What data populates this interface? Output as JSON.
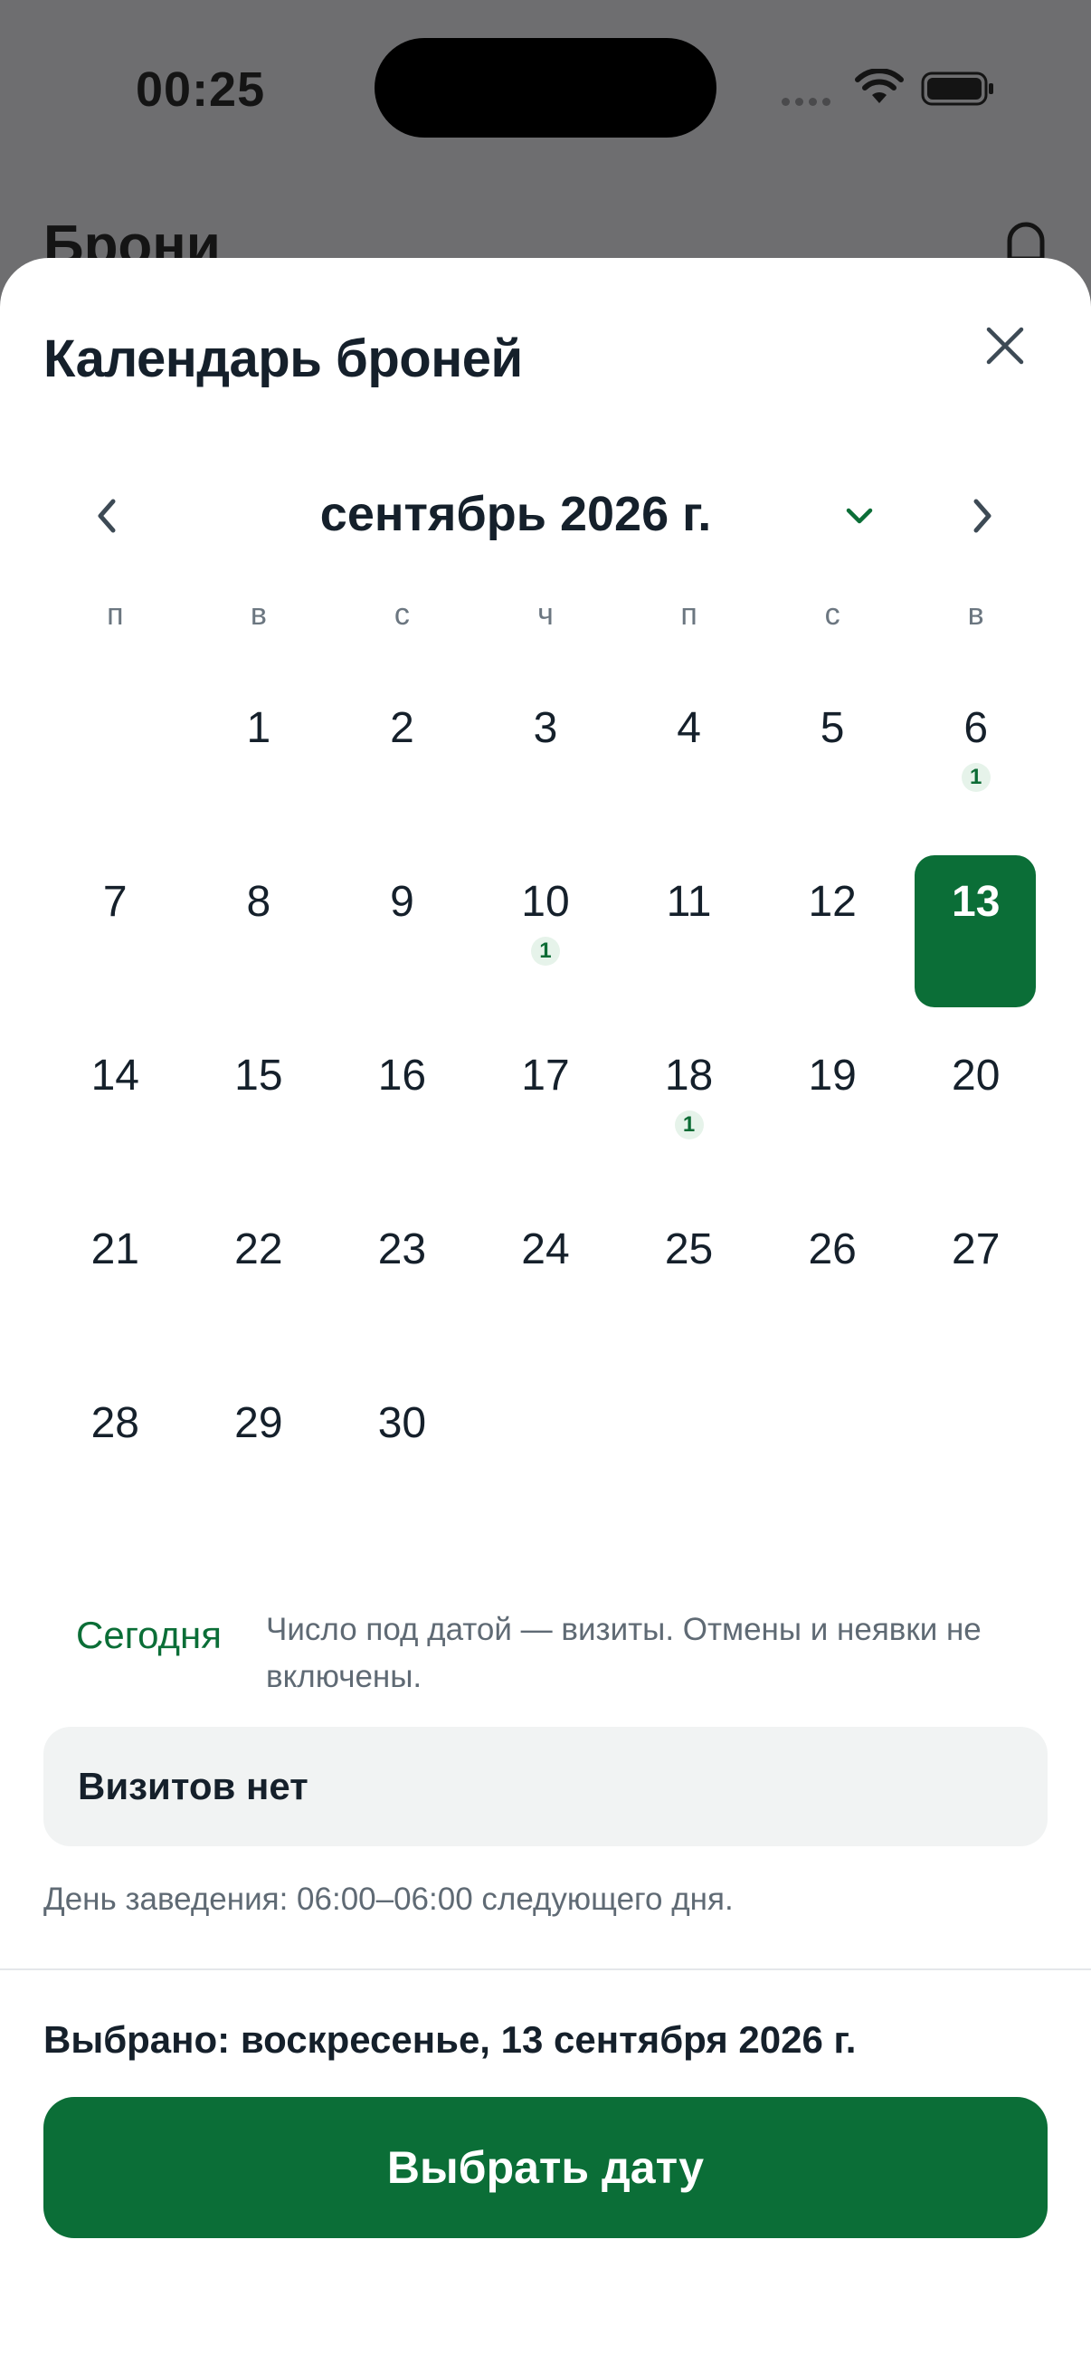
{
  "status_bar": {
    "time": "00:25"
  },
  "background": {
    "title": "Брони"
  },
  "sheet": {
    "title": "Календарь броней"
  },
  "calendar": {
    "month_label": "сентябрь 2026 г.",
    "weekdays": [
      "п",
      "в",
      "с",
      "ч",
      "п",
      "с",
      "в"
    ],
    "leading_empty": 1,
    "days": [
      {
        "num": "1"
      },
      {
        "num": "2"
      },
      {
        "num": "3"
      },
      {
        "num": "4"
      },
      {
        "num": "5"
      },
      {
        "num": "6",
        "count": "1"
      },
      {
        "num": "7"
      },
      {
        "num": "8"
      },
      {
        "num": "9"
      },
      {
        "num": "10",
        "count": "1"
      },
      {
        "num": "11"
      },
      {
        "num": "12"
      },
      {
        "num": "13",
        "selected": true
      },
      {
        "num": "14"
      },
      {
        "num": "15"
      },
      {
        "num": "16"
      },
      {
        "num": "17"
      },
      {
        "num": "18",
        "count": "1"
      },
      {
        "num": "19"
      },
      {
        "num": "20"
      },
      {
        "num": "21"
      },
      {
        "num": "22"
      },
      {
        "num": "23"
      },
      {
        "num": "24"
      },
      {
        "num": "25"
      },
      {
        "num": "26"
      },
      {
        "num": "27"
      },
      {
        "num": "28"
      },
      {
        "num": "29"
      },
      {
        "num": "30"
      }
    ]
  },
  "footer": {
    "today_label": "Сегодня",
    "legend": "Число под датой — визиты. Отмены и неявки не включены.",
    "visits_text": "Визитов нет",
    "day_note": "День заведения: 06:00–06:00 следующего дня.",
    "selected_text": "Выбрано: воскресенье, 13 сентября 2026 г.",
    "select_button": "Выбрать дату"
  },
  "colors": {
    "accent": "#0b6e37",
    "count_badge_bg": "#e6f3ea",
    "overlay": "#6e6e70"
  },
  "icons": {
    "close": "close-icon",
    "prev": "chevron-left-icon",
    "next": "chevron-right-icon",
    "month_dropdown": "chevron-down-icon"
  }
}
